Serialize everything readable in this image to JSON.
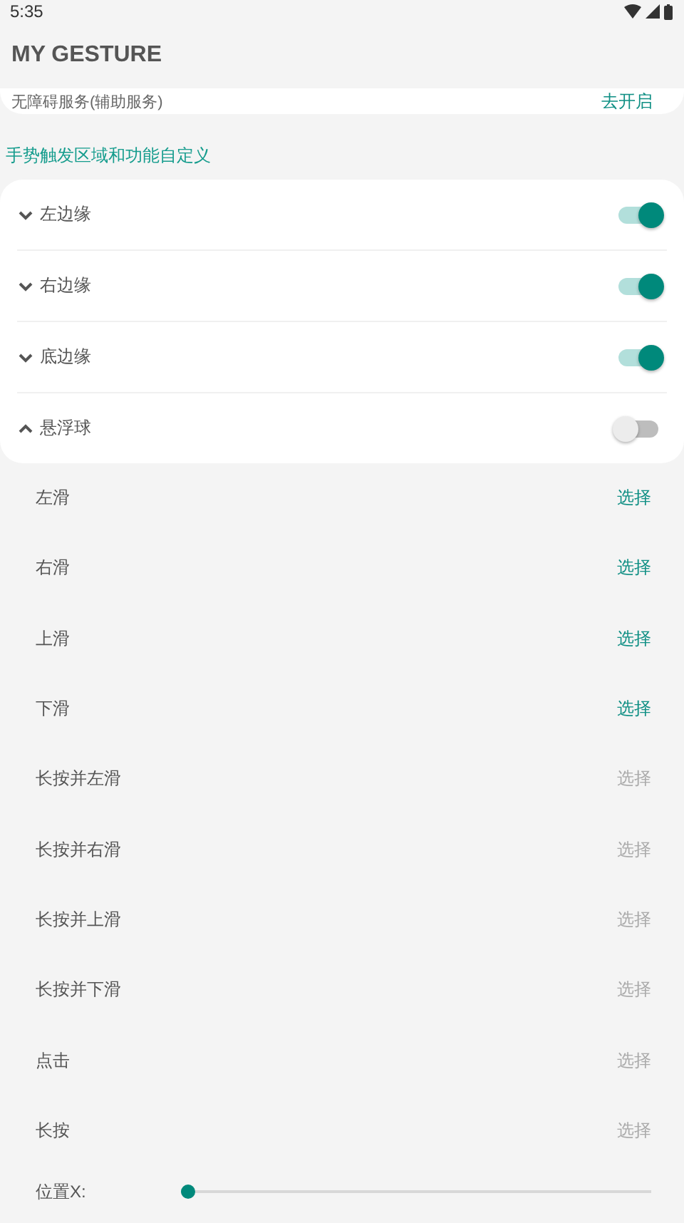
{
  "status_bar": {
    "time": "5:35"
  },
  "app_bar": {
    "title": "MY GESTURE"
  },
  "service_row": {
    "label": "无障碍服务(辅助服务)",
    "action": "去开启"
  },
  "section_title": "手势触发区域和功能自定义",
  "edges": [
    {
      "label": "左边缘",
      "expanded": false,
      "on": true
    },
    {
      "label": "右边缘",
      "expanded": false,
      "on": true
    },
    {
      "label": "底边缘",
      "expanded": false,
      "on": true
    },
    {
      "label": "悬浮球",
      "expanded": true,
      "on": false
    }
  ],
  "actions": [
    {
      "label": "左滑",
      "button": "选择",
      "disabled": false
    },
    {
      "label": "右滑",
      "button": "选择",
      "disabled": false
    },
    {
      "label": "上滑",
      "button": "选择",
      "disabled": false
    },
    {
      "label": "下滑",
      "button": "选择",
      "disabled": false
    },
    {
      "label": "长按并左滑",
      "button": "选择",
      "disabled": true
    },
    {
      "label": "长按并右滑",
      "button": "选择",
      "disabled": true
    },
    {
      "label": "长按并上滑",
      "button": "选择",
      "disabled": true
    },
    {
      "label": "长按并下滑",
      "button": "选择",
      "disabled": true
    },
    {
      "label": "点击",
      "button": "选择",
      "disabled": true
    },
    {
      "label": "长按",
      "button": "选择",
      "disabled": true
    }
  ],
  "position_x": {
    "label": "位置X:",
    "level": 0.0
  }
}
